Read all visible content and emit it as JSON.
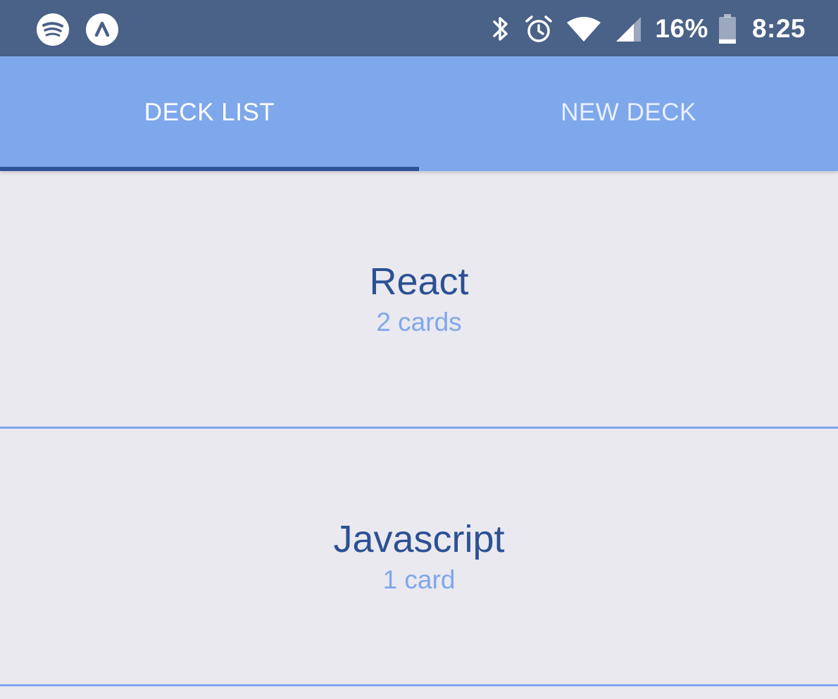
{
  "status_bar": {
    "left_icons": [
      "spotify-icon",
      "expo-icon"
    ],
    "right_icons": [
      "bluetooth-icon",
      "alarm-icon",
      "wifi-icon",
      "cell-signal-icon",
      "battery-icon"
    ],
    "battery_percent": "16%",
    "battery_level": 0.16,
    "time": "8:25"
  },
  "tabs": [
    {
      "label": "DECK LIST",
      "active": true
    },
    {
      "label": "NEW DECK",
      "active": false
    }
  ],
  "colors": {
    "status_bar": "#4a6188",
    "tab_bar": "#7fa7eb",
    "tab_indicator": "#2b5396",
    "background": "#eae9f0",
    "deck_title": "#2c5193",
    "deck_count": "#7fa7eb"
  },
  "decks": [
    {
      "title": "React",
      "count": "2 cards"
    },
    {
      "title": "Javascript",
      "count": "1 card"
    }
  ]
}
